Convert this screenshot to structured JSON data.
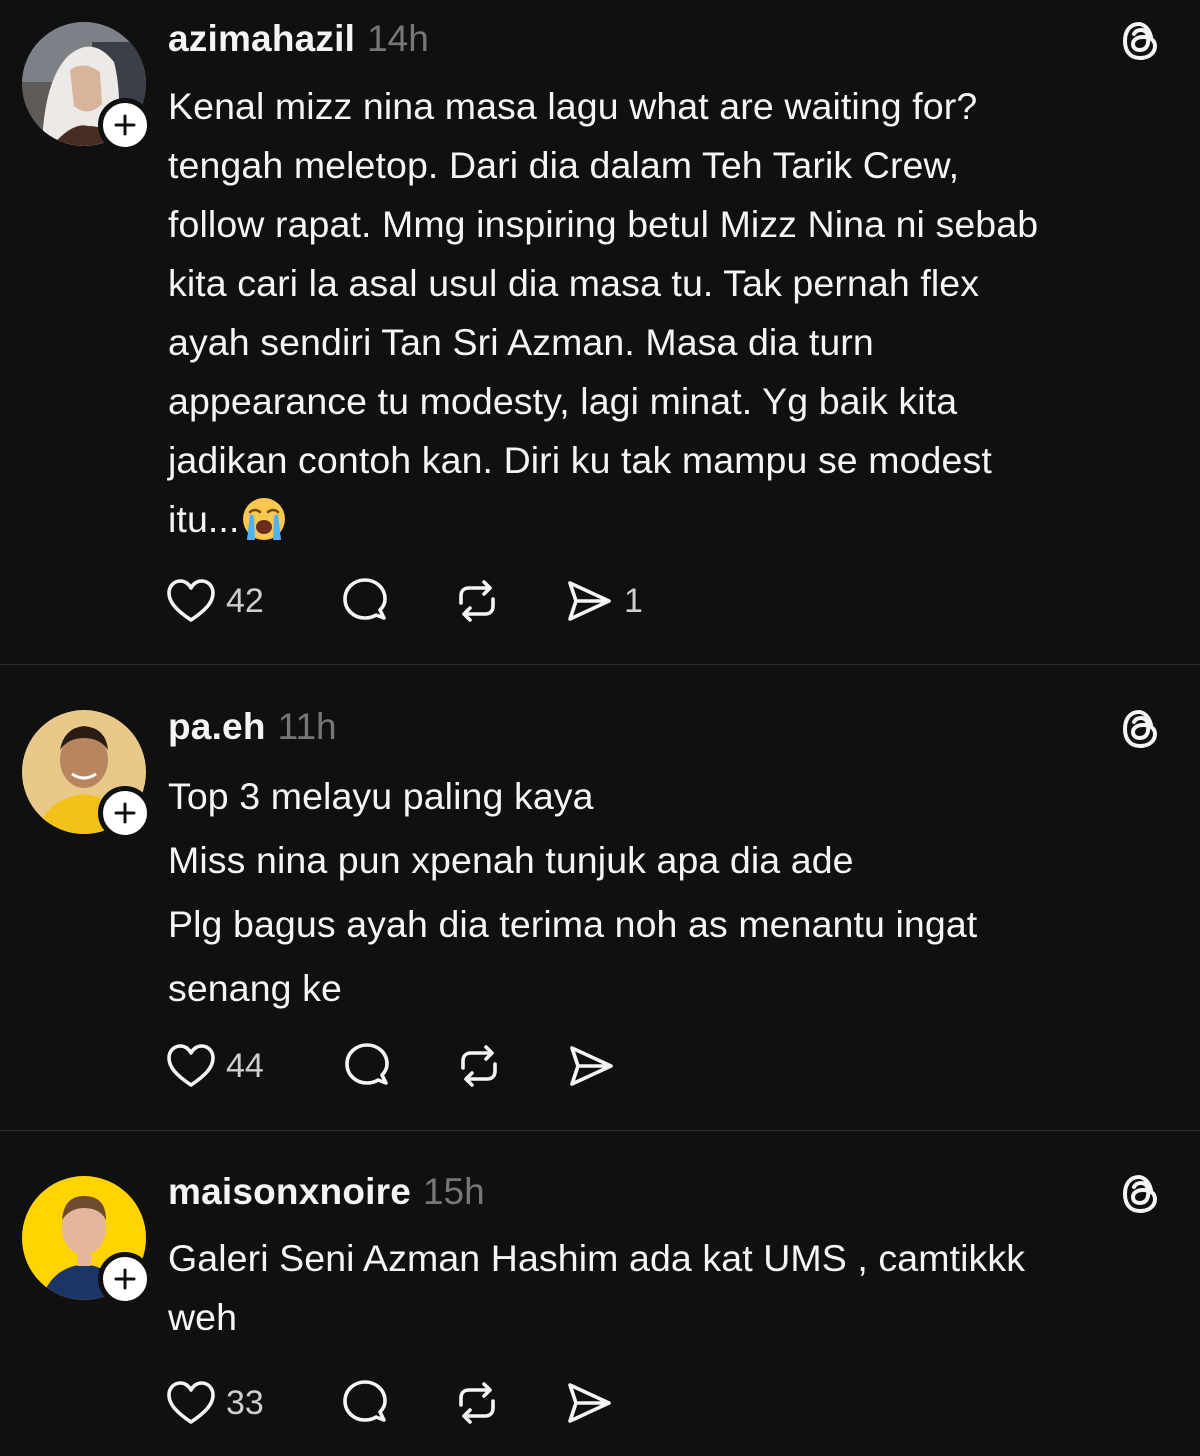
{
  "posts": [
    {
      "username": "azimahazil",
      "time": "14h",
      "text": "Kenal mizz nina masa lagu what are waiting for?\ntengah meletop. Dari dia dalam Teh Tarik Crew,\nfollow rapat. Mmg inspiring betul Mizz Nina ni sebab\nkita cari la asal usul dia masa tu. Tak pernah flex\nayah sendiri Tan Sri Azman. Masa dia turn\nappearance tu modesty, lagi minat. Yg baik kita\njadikan contoh kan. Diri ku tak mampu se modest\nitu...",
      "emoji": "loudly-crying-face",
      "likes": "42",
      "replies": "",
      "reposts": "",
      "shares": "1"
    },
    {
      "username": "pa.eh",
      "time": "11h",
      "text": "Top 3 melayu paling kaya\nMiss nina pun xpenah tunjuk apa dia ade\nPlg bagus ayah dia terima noh as menantu ingat\nsenang ke",
      "likes": "44",
      "replies": "",
      "reposts": "",
      "shares": ""
    },
    {
      "username": "maisonxnoire",
      "time": "15h",
      "text": "Galeri Seni Azman Hashim ada kat UMS , camtikkk\nweh",
      "likes": "33",
      "replies": "",
      "reposts": "",
      "shares": ""
    }
  ],
  "icons": {
    "like": "heart-icon",
    "reply": "comment-bubble-icon",
    "repost": "repost-icon",
    "share": "send-icon",
    "follow": "plus-icon",
    "brand": "threads-logo-icon"
  },
  "colors": {
    "background": "#101010",
    "text": "#f3f5f7",
    "muted": "#777777",
    "divider": "#2d2d2d",
    "avatar2_bg": "#f2c21a",
    "avatar3_bg": "#ffd400"
  }
}
